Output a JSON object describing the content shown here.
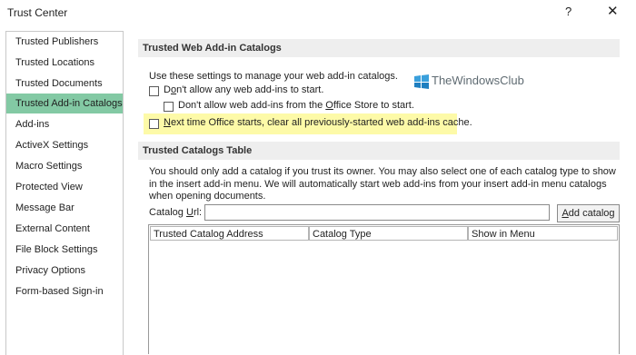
{
  "window": {
    "title": "Trust Center",
    "help_label": "?",
    "close_label": "✕"
  },
  "sidebar": {
    "items": [
      {
        "label": "Trusted Publishers"
      },
      {
        "label": "Trusted Locations"
      },
      {
        "label": "Trusted Documents"
      },
      {
        "label": "Trusted Add-in Catalogs",
        "selected": true
      },
      {
        "label": "Add-ins"
      },
      {
        "label": "ActiveX Settings"
      },
      {
        "label": "Macro Settings"
      },
      {
        "label": "Protected View"
      },
      {
        "label": "Message Bar"
      },
      {
        "label": "External Content"
      },
      {
        "label": "File Block Settings"
      },
      {
        "label": "Privacy Options"
      },
      {
        "label": "Form-based Sign-in"
      }
    ]
  },
  "web_catalogs": {
    "heading": "Trusted Web Add-in Catalogs",
    "description": "Use these settings to manage your web add-in catalogs.",
    "dont_allow_pre": "D",
    "dont_allow_key": "o",
    "dont_allow_post": "n't allow any web add-ins to start.",
    "office_store_pre": "Don't allow web add-ins from the ",
    "office_store_key": "O",
    "office_store_post": "ffice Store to start.",
    "clear_cache_key": "N",
    "clear_cache_post": "ext time Office starts, clear all previously-started web add-ins cache.",
    "highlight_color": "#fdfaa8"
  },
  "catalogs_table": {
    "heading": "Trusted Catalogs Table",
    "info": "You should only add a catalog if you trust its owner. You may also select one of each catalog type to show in the insert add-in menu. We will automatically start web add-ins from your insert add-in menu catalogs when opening documents.",
    "url_label_pre": "Catalog ",
    "url_label_key": "U",
    "url_label_post": "rl:",
    "url_value": "",
    "add_button_key": "A",
    "add_button_post": "dd catalog",
    "columns": [
      "Trusted Catalog Address",
      "Catalog Type",
      "Show in Menu"
    ]
  },
  "watermark": {
    "text": "TheWindowsClub",
    "logo_icon": "windows-club-logo-icon"
  },
  "colors": {
    "selected_nav": "#83c9a4",
    "section_header": "#eeeeee"
  }
}
